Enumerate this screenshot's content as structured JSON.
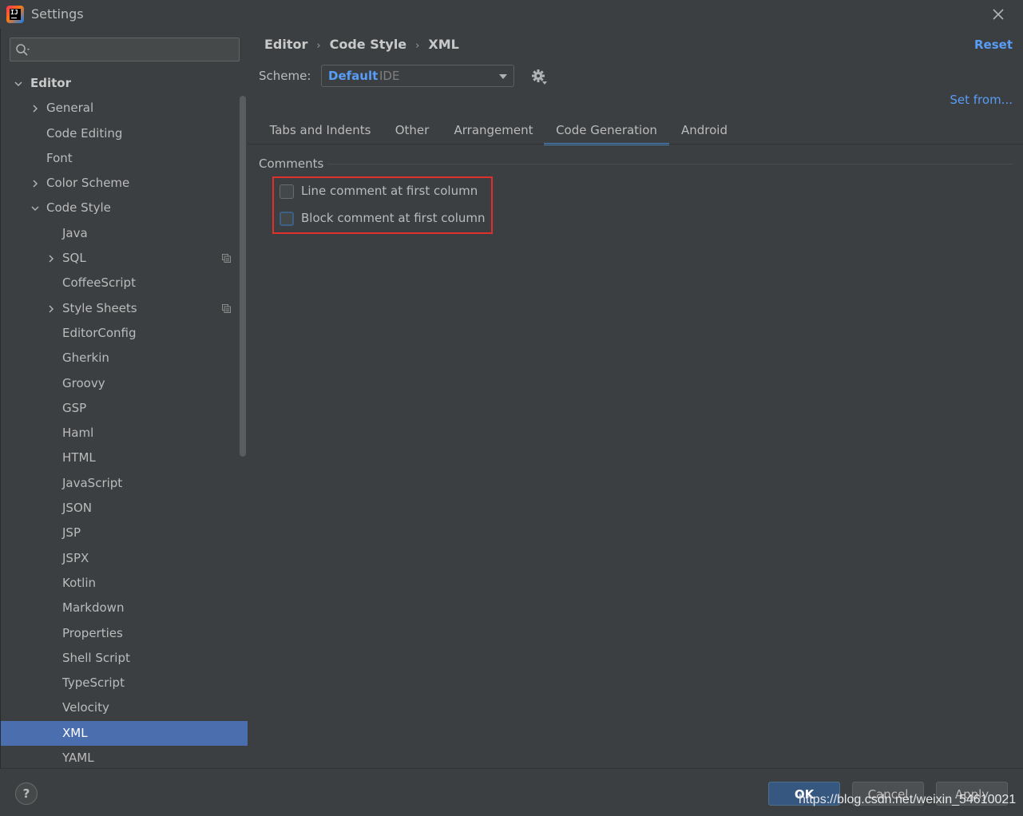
{
  "window": {
    "title": "Settings"
  },
  "search": {
    "placeholder": ""
  },
  "tree": [
    {
      "label": "Editor",
      "level": 0,
      "expanded": true,
      "bold": true
    },
    {
      "label": "General",
      "level": 1,
      "collapsed": true
    },
    {
      "label": "Code Editing",
      "level": 1
    },
    {
      "label": "Font",
      "level": 1
    },
    {
      "label": "Color Scheme",
      "level": 1,
      "collapsed": true
    },
    {
      "label": "Code Style",
      "level": 1,
      "expanded": true
    },
    {
      "label": "Java",
      "level": 2
    },
    {
      "label": "SQL",
      "level": 2,
      "collapsed": true,
      "copy_icon": true
    },
    {
      "label": "CoffeeScript",
      "level": 2
    },
    {
      "label": "Style Sheets",
      "level": 2,
      "collapsed": true,
      "copy_icon": true
    },
    {
      "label": "EditorConfig",
      "level": 2
    },
    {
      "label": "Gherkin",
      "level": 2
    },
    {
      "label": "Groovy",
      "level": 2
    },
    {
      "label": "GSP",
      "level": 2
    },
    {
      "label": "Haml",
      "level": 2
    },
    {
      "label": "HTML",
      "level": 2
    },
    {
      "label": "JavaScript",
      "level": 2
    },
    {
      "label": "JSON",
      "level": 2
    },
    {
      "label": "JSP",
      "level": 2
    },
    {
      "label": "JSPX",
      "level": 2
    },
    {
      "label": "Kotlin",
      "level": 2
    },
    {
      "label": "Markdown",
      "level": 2
    },
    {
      "label": "Properties",
      "level": 2
    },
    {
      "label": "Shell Script",
      "level": 2
    },
    {
      "label": "TypeScript",
      "level": 2
    },
    {
      "label": "Velocity",
      "level": 2
    },
    {
      "label": "XML",
      "level": 2,
      "selected": true
    },
    {
      "label": "YAML",
      "level": 2
    }
  ],
  "breadcrumb": {
    "part1": "Editor",
    "part2": "Code Style",
    "part3": "XML",
    "sep": "›"
  },
  "header": {
    "reset_label": "Reset",
    "set_from_label": "Set from..."
  },
  "scheme": {
    "label": "Scheme:",
    "value": "Default",
    "sub": "IDE"
  },
  "tabs": [
    {
      "label": "Tabs and Indents",
      "active": false
    },
    {
      "label": "Other",
      "active": false
    },
    {
      "label": "Arrangement",
      "active": false
    },
    {
      "label": "Code Generation",
      "active": true
    },
    {
      "label": "Android",
      "active": false
    }
  ],
  "comments": {
    "section_title": "Comments",
    "line_comment_label": "Line comment at first column",
    "line_comment_checked": false,
    "block_comment_label": "Block comment at first column",
    "block_comment_checked": false
  },
  "footer": {
    "help_label": "?",
    "ok_label": "OK",
    "cancel_label": "Cancel",
    "apply_label": "Apply",
    "watermark": "https://blog.csdn.net/weixin_54610021"
  },
  "colors": {
    "background": "#3c3f41",
    "selection": "#4b6eaf",
    "link": "#589df6",
    "highlight_box": "#e0302c"
  }
}
